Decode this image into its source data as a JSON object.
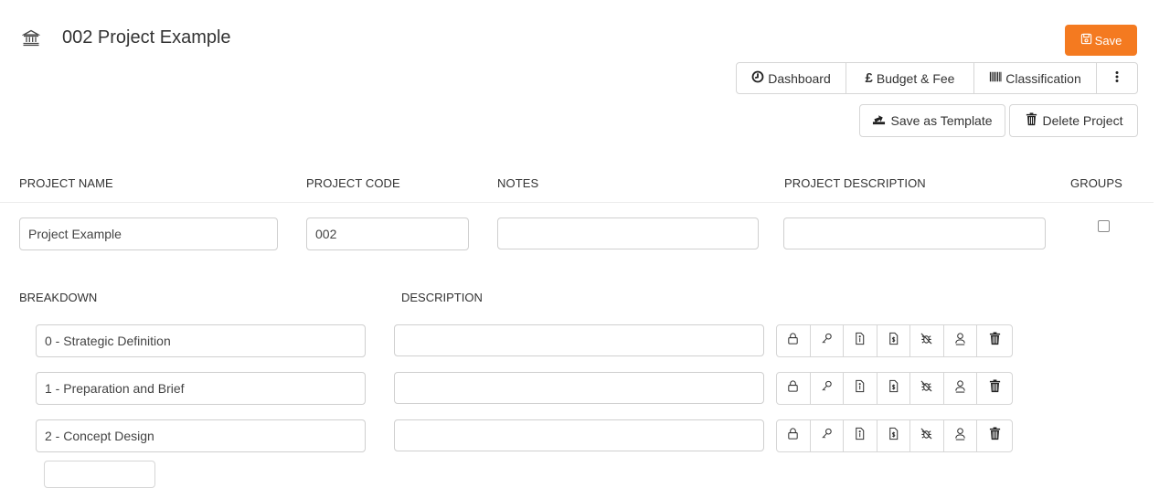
{
  "header": {
    "title": "002 Project Example",
    "icon": "bank-building-icon",
    "save_label": "Save"
  },
  "colors": {
    "accent": "#f47a20",
    "border": "#d6d6d6",
    "text": "#333333"
  },
  "toolbar": {
    "dashboard_label": "Dashboard",
    "budget_label": "Budget & Fee",
    "classification_label": "Classification",
    "save_template_label": "Save as Template",
    "delete_project_label": "Delete Project"
  },
  "columns": {
    "project_name": "PROJECT NAME",
    "project_code": "PROJECT CODE",
    "notes": "NOTES",
    "project_description": "PROJECT DESCRIPTION",
    "groups": "GROUPS"
  },
  "fields": {
    "project_name": "Project Example",
    "project_code": "002",
    "notes": "",
    "project_description": "",
    "groups_checked": false
  },
  "breakdown": {
    "breakdown_header": "BREAKDOWN",
    "description_header": "DESCRIPTION",
    "rows": [
      {
        "name": "0 - Strategic Definition",
        "description": ""
      },
      {
        "name": "1 - Preparation and Brief",
        "description": ""
      },
      {
        "name": "2 - Concept Design",
        "description": ""
      }
    ],
    "row_actions": [
      "lock-icon",
      "key-icon",
      "file-info-icon",
      "file-currency-icon",
      "bug-off-icon",
      "user-icon",
      "trash-icon"
    ]
  }
}
